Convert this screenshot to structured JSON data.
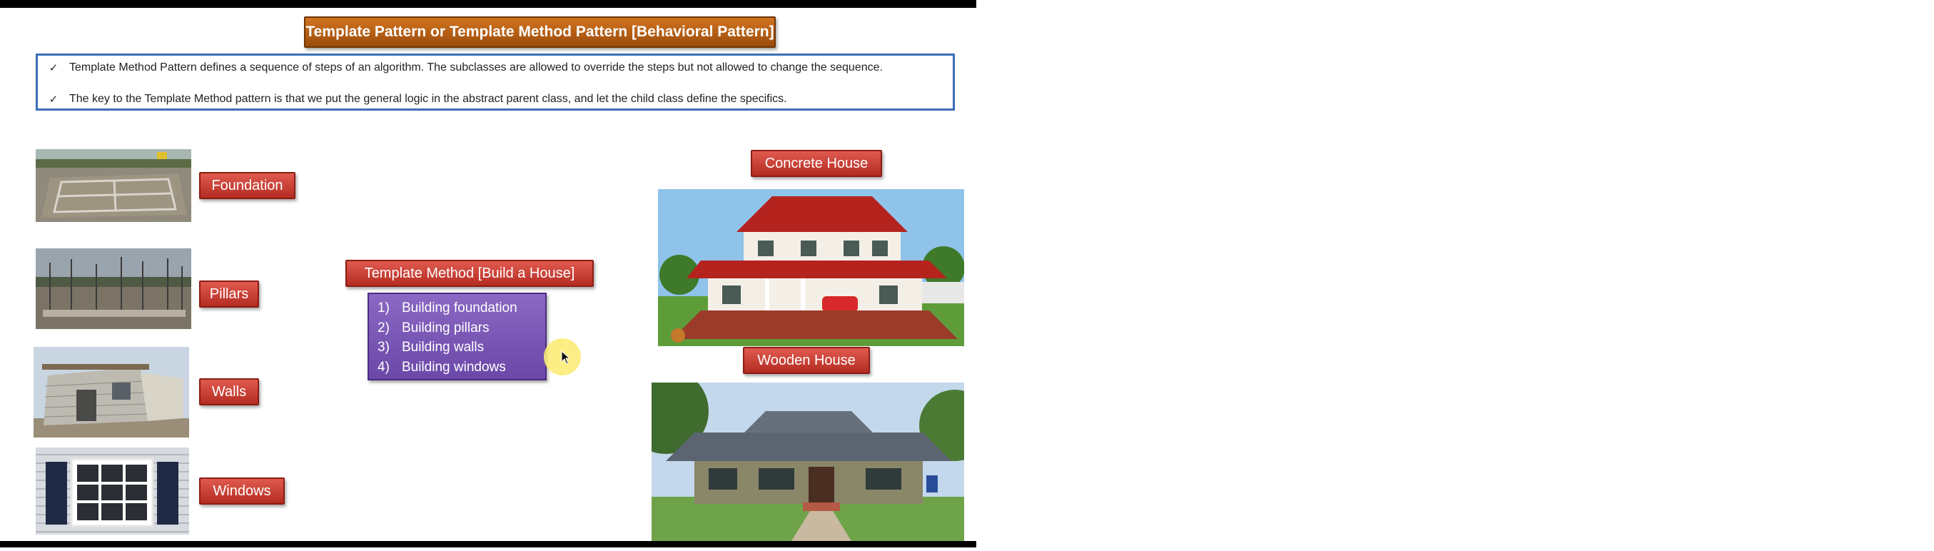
{
  "slide": {
    "title": "Template Pattern or Template Method Pattern [Behavioral Pattern]",
    "bullets": [
      "Template Method Pattern defines a sequence of steps of an algorithm. The subclasses are allowed to override the steps but not allowed to change the sequence.",
      "The key to the Template Method pattern is that we put the general logic in the abstract parent class, and let the child class define the specifics."
    ],
    "bullet_icon": "checkmark",
    "parts": [
      {
        "label": "Foundation",
        "image": "foundation-photo"
      },
      {
        "label": "Pillars",
        "image": "pillars-photo"
      },
      {
        "label": "Walls",
        "image": "walls-photo"
      },
      {
        "label": "Windows",
        "image": "windows-photo"
      }
    ],
    "template_method": {
      "heading": "Template Method [Build a House]",
      "steps": [
        {
          "num": "1)",
          "text": "Building foundation"
        },
        {
          "num": "2)",
          "text": "Building pillars"
        },
        {
          "num": "3)",
          "text": "Building walls"
        },
        {
          "num": "4)",
          "text": "Building windows"
        }
      ]
    },
    "houses": [
      {
        "label": "Concrete House",
        "image": "concrete-house-photo"
      },
      {
        "label": "Wooden House",
        "image": "wooden-house-photo"
      }
    ]
  },
  "colors": {
    "title_bg": "#b8621a",
    "label_bg": "#c9392e",
    "steps_bg": "#7b58b5",
    "box_border": "#3b6fb5",
    "cursor_halo": "#fcec78"
  }
}
